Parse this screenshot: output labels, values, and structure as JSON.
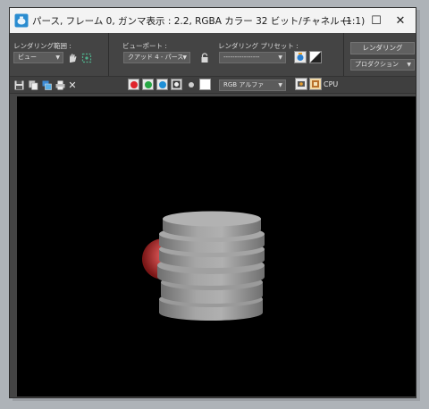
{
  "window": {
    "title": "パース, フレーム 0, ガンマ表示 : 2.2, RGBA カラー 32 ビット/チャネル (1:1)",
    "controls": {
      "minimize": "—",
      "maximize": "☐",
      "close": "✕"
    }
  },
  "panel": {
    "render_area_label": "レンダリング範囲 :",
    "render_area_value": "ビュー",
    "viewport_label": "ビューポート :",
    "viewport_value": "クアッド 4 - パース",
    "preset_label": "レンダリング プリセット :",
    "preset_value": "----------------",
    "render_button": "レンダリング",
    "mode_value": "プロダクション"
  },
  "toolbar": {
    "channel_value": "RGB アルファ",
    "cpu_label": "CPU"
  },
  "colors": {
    "red_channel": "#e0242c",
    "green_channel": "#27a844",
    "blue_channel": "#1e8fd6",
    "background": "#000000",
    "object_gray": "#a9a9a9",
    "sphere_red": "#c83a3a"
  },
  "scene": {
    "objects": [
      "stacked-cylinder-disks",
      "red-sphere"
    ]
  }
}
